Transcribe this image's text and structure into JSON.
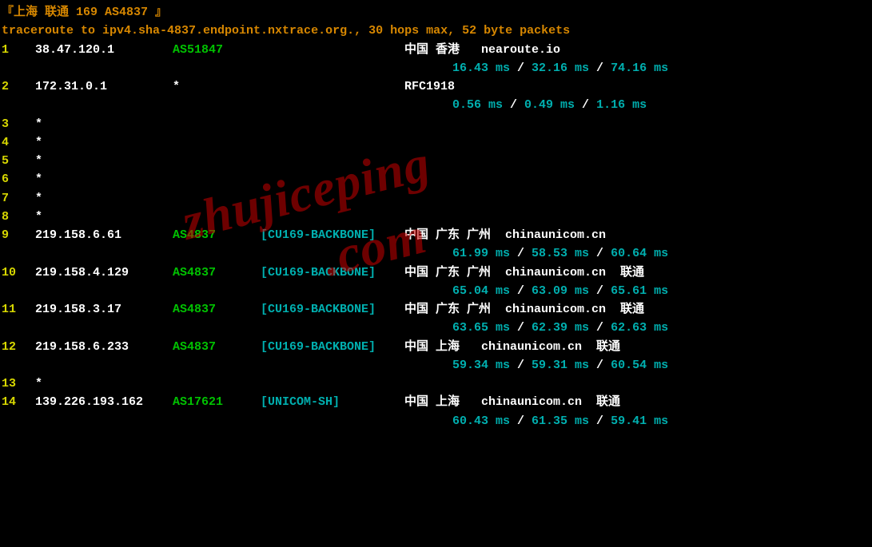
{
  "header": {
    "title": "『上海 联通 169 AS4837 』",
    "trace_info": "traceroute to ipv4.sha-4837.endpoint.nxtrace.org., 30 hops max, 52 byte packets"
  },
  "watermark": {
    "line1": "zhujiceping",
    "line2": ".com"
  },
  "hops": [
    {
      "num": "1",
      "ip": "38.47.120.1",
      "asn": "AS51847",
      "backbone": "",
      "geo": "中国 香港   nearoute.io",
      "lat": [
        "16.43 ms",
        "32.16 ms",
        "74.16 ms"
      ]
    },
    {
      "num": "2",
      "ip": "172.31.0.1",
      "asn": "*",
      "backbone": "",
      "geo": "RFC1918",
      "lat": [
        "0.56 ms",
        "0.49 ms",
        "1.16 ms"
      ]
    },
    {
      "num": "3",
      "ip": "*",
      "blank": true
    },
    {
      "num": "4",
      "ip": "*",
      "blank": true
    },
    {
      "num": "5",
      "ip": "*",
      "blank": true
    },
    {
      "num": "6",
      "ip": "*",
      "blank": true
    },
    {
      "num": "7",
      "ip": "*",
      "blank": true
    },
    {
      "num": "8",
      "ip": "*",
      "blank": true
    },
    {
      "num": "9",
      "ip": "219.158.6.61",
      "asn": "AS4837",
      "backbone": "[CU169-BACKBONE]",
      "geo": "中国 广东 广州  chinaunicom.cn",
      "lat": [
        "61.99 ms",
        "58.53 ms",
        "60.64 ms"
      ]
    },
    {
      "num": "10",
      "ip": "219.158.4.129",
      "asn": "AS4837",
      "backbone": "[CU169-BACKBONE]",
      "geo": "中国 广东 广州  chinaunicom.cn  联通",
      "lat": [
        "65.04 ms",
        "63.09 ms",
        "65.61 ms"
      ]
    },
    {
      "num": "11",
      "ip": "219.158.3.17",
      "asn": "AS4837",
      "backbone": "[CU169-BACKBONE]",
      "geo": "中国 广东 广州  chinaunicom.cn  联通",
      "lat": [
        "63.65 ms",
        "62.39 ms",
        "62.63 ms"
      ]
    },
    {
      "num": "12",
      "ip": "219.158.6.233",
      "asn": "AS4837",
      "backbone": "[CU169-BACKBONE]",
      "geo": "中国 上海   chinaunicom.cn  联通",
      "lat": [
        "59.34 ms",
        "59.31 ms",
        "60.54 ms"
      ]
    },
    {
      "num": "13",
      "ip": "*",
      "blank": true
    },
    {
      "num": "14",
      "ip": "139.226.193.162",
      "asn": "AS17621",
      "backbone": "[UNICOM-SH]",
      "geo": "中国 上海   chinaunicom.cn  联通",
      "lat": [
        "60.43 ms",
        "61.35 ms",
        "59.41 ms"
      ]
    }
  ]
}
